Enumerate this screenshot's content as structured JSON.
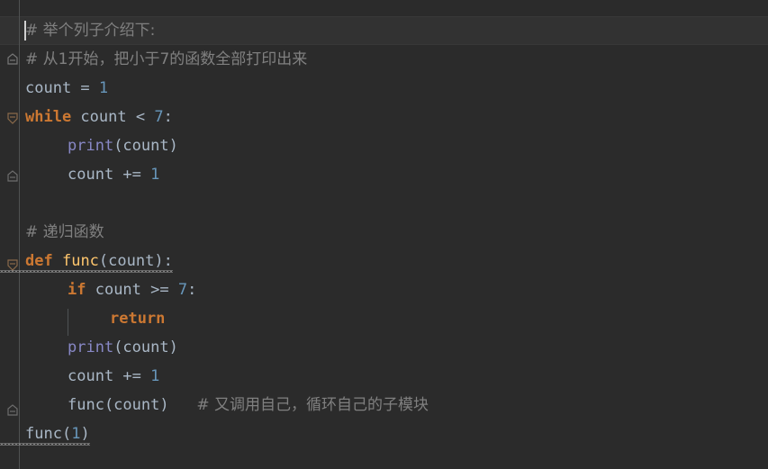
{
  "editor": {
    "theme_name": "darcula",
    "background": "#2b2b2b",
    "current_line_background": "#323232",
    "gutter_line_color": "#4f5152",
    "colors": {
      "keyword": "#cc7832",
      "number": "#6897bb",
      "function_name": "#ffc66d",
      "builtin": "#8888c6",
      "comment": "#808080",
      "identifier": "#a9b7c6"
    },
    "caret": {
      "line": 1,
      "column": 1
    },
    "lines": [
      {
        "n": 1,
        "current": true,
        "indent": 0,
        "tokens": [
          {
            "t": "# 举个列子介绍下:",
            "c": "cmt"
          }
        ]
      },
      {
        "n": 2,
        "indent": 0,
        "fold": "fold-end-top",
        "tokens": [
          {
            "t": "# 从1开始，把小于7的函数全部打印出来",
            "c": "cmt"
          }
        ]
      },
      {
        "n": 3,
        "indent": 0,
        "tokens": [
          {
            "t": "count",
            "c": "id"
          },
          {
            "t": " = ",
            "c": "op"
          },
          {
            "t": "1",
            "c": "num"
          }
        ]
      },
      {
        "n": 4,
        "indent": 0,
        "fold": "expanded",
        "tokens": [
          {
            "t": "while",
            "c": "kw"
          },
          {
            "t": " count ",
            "c": "id"
          },
          {
            "t": "< ",
            "c": "op"
          },
          {
            "t": "7",
            "c": "num"
          },
          {
            "t": ":",
            "c": "punc"
          }
        ]
      },
      {
        "n": 5,
        "indent": 1,
        "tokens": [
          {
            "t": "print",
            "c": "bi"
          },
          {
            "t": "(count)",
            "c": "punc"
          }
        ]
      },
      {
        "n": 6,
        "indent": 1,
        "fold": "fold-end",
        "tokens": [
          {
            "t": "count ",
            "c": "id"
          },
          {
            "t": "+= ",
            "c": "op"
          },
          {
            "t": "1",
            "c": "num"
          }
        ]
      },
      {
        "n": 7,
        "indent": 0,
        "tokens": []
      },
      {
        "n": 8,
        "indent": 0,
        "tokens": [
          {
            "t": "# 递归函数",
            "c": "cmt"
          }
        ]
      },
      {
        "n": 9,
        "indent": 0,
        "fold": "expanded",
        "squiggle": true,
        "tokens": [
          {
            "t": "def",
            "c": "kw"
          },
          {
            "t": " ",
            "c": "op"
          },
          {
            "t": "func",
            "c": "fn"
          },
          {
            "t": "(count):",
            "c": "punc"
          }
        ]
      },
      {
        "n": 10,
        "indent": 1,
        "tokens": [
          {
            "t": "if",
            "c": "kw"
          },
          {
            "t": " count ",
            "c": "id"
          },
          {
            "t": ">= ",
            "c": "op"
          },
          {
            "t": "7",
            "c": "num"
          },
          {
            "t": ":",
            "c": "punc"
          }
        ]
      },
      {
        "n": 11,
        "indent": 2,
        "tokens": [
          {
            "t": "return",
            "c": "kw"
          }
        ]
      },
      {
        "n": 12,
        "indent": 1,
        "tokens": [
          {
            "t": "print",
            "c": "bi"
          },
          {
            "t": "(count)",
            "c": "punc"
          }
        ]
      },
      {
        "n": 13,
        "indent": 1,
        "tokens": [
          {
            "t": "count ",
            "c": "id"
          },
          {
            "t": "+= ",
            "c": "op"
          },
          {
            "t": "1",
            "c": "num"
          }
        ]
      },
      {
        "n": 14,
        "indent": 1,
        "fold": "fold-end",
        "tokens": [
          {
            "t": "func(count)",
            "c": "id"
          },
          {
            "t": "   ",
            "c": "op"
          },
          {
            "t": "# 又调用自己，循环自己的子模块",
            "c": "cmt"
          }
        ]
      },
      {
        "n": 15,
        "indent": 0,
        "squiggle": true,
        "tokens": [
          {
            "t": "func",
            "c": "id"
          },
          {
            "t": "(",
            "c": "punc"
          },
          {
            "t": "1",
            "c": "num"
          },
          {
            "t": ")",
            "c": "punc"
          }
        ]
      }
    ]
  }
}
